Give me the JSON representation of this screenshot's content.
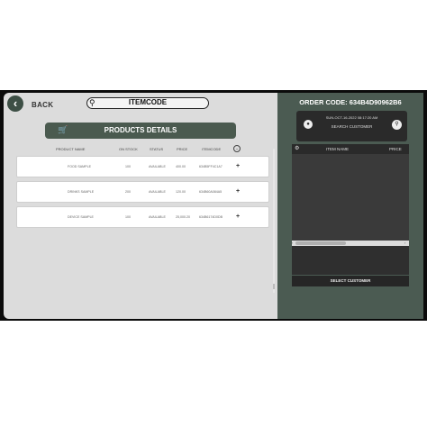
{
  "header": {
    "back_label": "BACK",
    "search_value": "ITEMCODE"
  },
  "products": {
    "title": "PRODUCTS DETAILS",
    "columns": [
      "PRODUCT NAME",
      "ON STOCK",
      "STATUS",
      "PRICE",
      "ITEMCODE"
    ],
    "rows": [
      {
        "name": "FOOD SAMPLE",
        "stock": "100",
        "status": "AVAILABLE",
        "price": "400.00",
        "code": "634B5FF4C1A7"
      },
      {
        "name": "DRINKS SAMPLE",
        "stock": "200",
        "status": "AVAILABLE",
        "price": "120.00",
        "code": "634B60A084A5"
      },
      {
        "name": "DEVICE SAMPLE",
        "stock": "100",
        "status": "AVAILABLE",
        "price": "25,000.20",
        "code": "634B6174D0DB"
      }
    ]
  },
  "order": {
    "code_label": "ORDER CODE: 634B4D90962B6",
    "datetime": "SUN-OCT-16-2022 08:17:20 AM",
    "search_customer": "SEARCH CUSTOMER",
    "col_item_name": "ITEM NAME",
    "col_price": "PRICE",
    "select_customer": "SELECT CUSTOMER"
  },
  "colors": {
    "accent_dark_green": "#4a5a4f",
    "panel_green": "#4b5b52"
  }
}
